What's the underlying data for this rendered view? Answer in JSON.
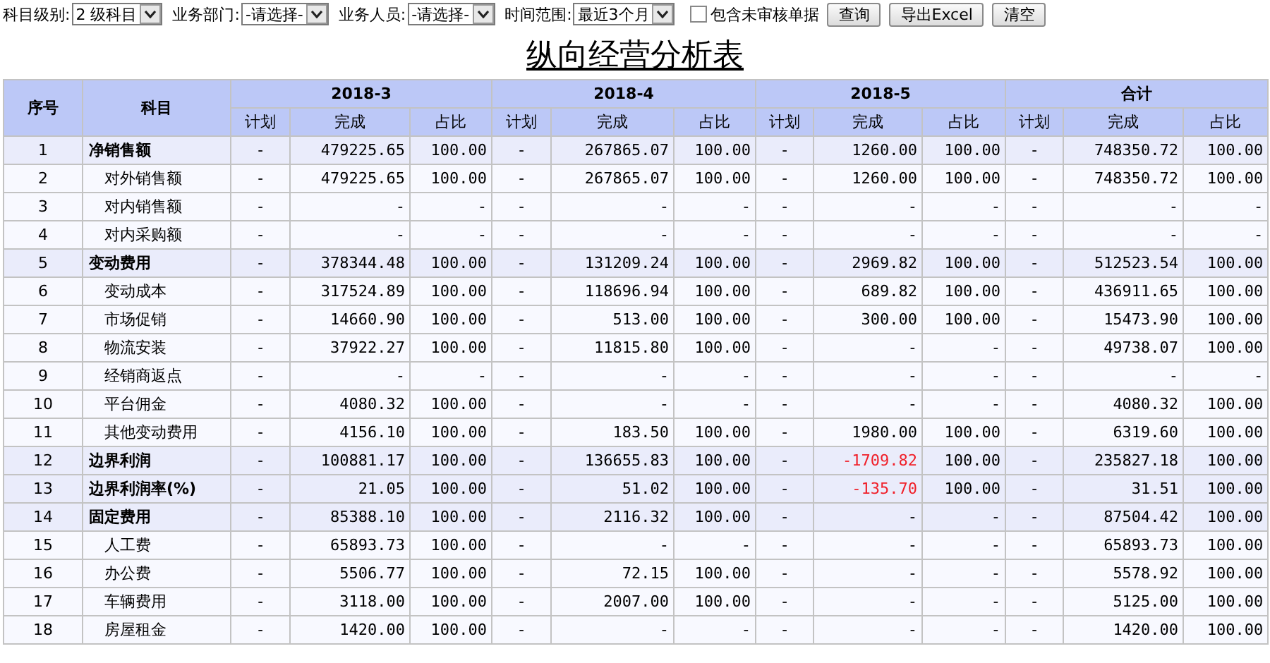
{
  "filters": [
    {
      "label": "科目级别:",
      "value": "2 级科目",
      "kind": "select"
    },
    {
      "label": "业务部门:",
      "value": "-请选择-",
      "kind": "select"
    },
    {
      "label": "业务人员:",
      "value": "-请选择-",
      "kind": "select"
    },
    {
      "label": "时间范围:",
      "value": "最近3个月",
      "kind": "select"
    }
  ],
  "checkbox": {
    "label": "包含未审核单据",
    "checked": false
  },
  "buttons": [
    "查询",
    "导出Excel",
    "清空"
  ],
  "title": "纵向经营分析表",
  "table": {
    "col_index": "序号",
    "col_subject": "科目",
    "periods": [
      {
        "label": "2018-3",
        "sub_columns": [
          "计划",
          "完成",
          "占比"
        ]
      },
      {
        "label": "2018-4",
        "sub_columns": [
          "计划",
          "完成",
          "占比"
        ]
      },
      {
        "label": "2018-5",
        "sub_columns": [
          "计划",
          "完成",
          "占比"
        ]
      },
      {
        "label": "合计",
        "sub_columns": [
          "计划",
          "完成",
          "占比"
        ]
      }
    ],
    "rows": [
      {
        "no": "1",
        "subject": "净销售额",
        "kind": "group",
        "cells": [
          {
            "plan": "-",
            "done": "479225.65",
            "share": "100.00",
            "negative": false
          },
          {
            "plan": "-",
            "done": "267865.07",
            "share": "100.00",
            "negative": false
          },
          {
            "plan": "-",
            "done": "1260.00",
            "share": "100.00",
            "negative": false
          },
          {
            "plan": "-",
            "done": "748350.72",
            "share": "100.00",
            "negative": false
          }
        ]
      },
      {
        "no": "2",
        "subject": "对外销售额",
        "kind": "item",
        "cells": [
          {
            "plan": "-",
            "done": "479225.65",
            "share": "100.00",
            "negative": false
          },
          {
            "plan": "-",
            "done": "267865.07",
            "share": "100.00",
            "negative": false
          },
          {
            "plan": "-",
            "done": "1260.00",
            "share": "100.00",
            "negative": false
          },
          {
            "plan": "-",
            "done": "748350.72",
            "share": "100.00",
            "negative": false
          }
        ]
      },
      {
        "no": "3",
        "subject": "对内销售额",
        "kind": "item",
        "cells": [
          {
            "plan": "-",
            "done": "-",
            "share": "-",
            "negative": false
          },
          {
            "plan": "-",
            "done": "-",
            "share": "-",
            "negative": false
          },
          {
            "plan": "-",
            "done": "-",
            "share": "-",
            "negative": false
          },
          {
            "plan": "-",
            "done": "-",
            "share": "-",
            "negative": false
          }
        ]
      },
      {
        "no": "4",
        "subject": "对内采购额",
        "kind": "item",
        "cells": [
          {
            "plan": "-",
            "done": "-",
            "share": "-",
            "negative": false
          },
          {
            "plan": "-",
            "done": "-",
            "share": "-",
            "negative": false
          },
          {
            "plan": "-",
            "done": "-",
            "share": "-",
            "negative": false
          },
          {
            "plan": "-",
            "done": "-",
            "share": "-",
            "negative": false
          }
        ]
      },
      {
        "no": "5",
        "subject": "变动费用",
        "kind": "group",
        "cells": [
          {
            "plan": "-",
            "done": "378344.48",
            "share": "100.00",
            "negative": false
          },
          {
            "plan": "-",
            "done": "131209.24",
            "share": "100.00",
            "negative": false
          },
          {
            "plan": "-",
            "done": "2969.82",
            "share": "100.00",
            "negative": false
          },
          {
            "plan": "-",
            "done": "512523.54",
            "share": "100.00",
            "negative": false
          }
        ]
      },
      {
        "no": "6",
        "subject": "变动成本",
        "kind": "item",
        "cells": [
          {
            "plan": "-",
            "done": "317524.89",
            "share": "100.00",
            "negative": false
          },
          {
            "plan": "-",
            "done": "118696.94",
            "share": "100.00",
            "negative": false
          },
          {
            "plan": "-",
            "done": "689.82",
            "share": "100.00",
            "negative": false
          },
          {
            "plan": "-",
            "done": "436911.65",
            "share": "100.00",
            "negative": false
          }
        ]
      },
      {
        "no": "7",
        "subject": "市场促销",
        "kind": "item",
        "cells": [
          {
            "plan": "-",
            "done": "14660.90",
            "share": "100.00",
            "negative": false
          },
          {
            "plan": "-",
            "done": "513.00",
            "share": "100.00",
            "negative": false
          },
          {
            "plan": "-",
            "done": "300.00",
            "share": "100.00",
            "negative": false
          },
          {
            "plan": "-",
            "done": "15473.90",
            "share": "100.00",
            "negative": false
          }
        ]
      },
      {
        "no": "8",
        "subject": "物流安装",
        "kind": "item",
        "cells": [
          {
            "plan": "-",
            "done": "37922.27",
            "share": "100.00",
            "negative": false
          },
          {
            "plan": "-",
            "done": "11815.80",
            "share": "100.00",
            "negative": false
          },
          {
            "plan": "-",
            "done": "-",
            "share": "-",
            "negative": false
          },
          {
            "plan": "-",
            "done": "49738.07",
            "share": "100.00",
            "negative": false
          }
        ]
      },
      {
        "no": "9",
        "subject": "经销商返点",
        "kind": "item",
        "cells": [
          {
            "plan": "-",
            "done": "-",
            "share": "-",
            "negative": false
          },
          {
            "plan": "-",
            "done": "-",
            "share": "-",
            "negative": false
          },
          {
            "plan": "-",
            "done": "-",
            "share": "-",
            "negative": false
          },
          {
            "plan": "-",
            "done": "-",
            "share": "-",
            "negative": false
          }
        ]
      },
      {
        "no": "10",
        "subject": "平台佣金",
        "kind": "item",
        "cells": [
          {
            "plan": "-",
            "done": "4080.32",
            "share": "100.00",
            "negative": false
          },
          {
            "plan": "-",
            "done": "-",
            "share": "-",
            "negative": false
          },
          {
            "plan": "-",
            "done": "-",
            "share": "-",
            "negative": false
          },
          {
            "plan": "-",
            "done": "4080.32",
            "share": "100.00",
            "negative": false
          }
        ]
      },
      {
        "no": "11",
        "subject": "其他变动费用",
        "kind": "item",
        "cells": [
          {
            "plan": "-",
            "done": "4156.10",
            "share": "100.00",
            "negative": false
          },
          {
            "plan": "-",
            "done": "183.50",
            "share": "100.00",
            "negative": false
          },
          {
            "plan": "-",
            "done": "1980.00",
            "share": "100.00",
            "negative": false
          },
          {
            "plan": "-",
            "done": "6319.60",
            "share": "100.00",
            "negative": false
          }
        ]
      },
      {
        "no": "12",
        "subject": "边界利润",
        "kind": "group",
        "cells": [
          {
            "plan": "-",
            "done": "100881.17",
            "share": "100.00",
            "negative": false
          },
          {
            "plan": "-",
            "done": "136655.83",
            "share": "100.00",
            "negative": false
          },
          {
            "plan": "-",
            "done": "-1709.82",
            "share": "100.00",
            "negative": true
          },
          {
            "plan": "-",
            "done": "235827.18",
            "share": "100.00",
            "negative": false
          }
        ]
      },
      {
        "no": "13",
        "subject": "边界利润率(%)",
        "kind": "group",
        "cells": [
          {
            "plan": "-",
            "done": "21.05",
            "share": "100.00",
            "negative": false
          },
          {
            "plan": "-",
            "done": "51.02",
            "share": "100.00",
            "negative": false
          },
          {
            "plan": "-",
            "done": "-135.70",
            "share": "100.00",
            "negative": true
          },
          {
            "plan": "-",
            "done": "31.51",
            "share": "100.00",
            "negative": false
          }
        ]
      },
      {
        "no": "14",
        "subject": "固定费用",
        "kind": "group",
        "cells": [
          {
            "plan": "-",
            "done": "85388.10",
            "share": "100.00",
            "negative": false
          },
          {
            "plan": "-",
            "done": "2116.32",
            "share": "100.00",
            "negative": false
          },
          {
            "plan": "-",
            "done": "-",
            "share": "-",
            "negative": false
          },
          {
            "plan": "-",
            "done": "87504.42",
            "share": "100.00",
            "negative": false
          }
        ]
      },
      {
        "no": "15",
        "subject": "人工费",
        "kind": "item",
        "cells": [
          {
            "plan": "-",
            "done": "65893.73",
            "share": "100.00",
            "negative": false
          },
          {
            "plan": "-",
            "done": "-",
            "share": "-",
            "negative": false
          },
          {
            "plan": "-",
            "done": "-",
            "share": "-",
            "negative": false
          },
          {
            "plan": "-",
            "done": "65893.73",
            "share": "100.00",
            "negative": false
          }
        ]
      },
      {
        "no": "16",
        "subject": "办公费",
        "kind": "item",
        "cells": [
          {
            "plan": "-",
            "done": "5506.77",
            "share": "100.00",
            "negative": false
          },
          {
            "plan": "-",
            "done": "72.15",
            "share": "100.00",
            "negative": false
          },
          {
            "plan": "-",
            "done": "-",
            "share": "-",
            "negative": false
          },
          {
            "plan": "-",
            "done": "5578.92",
            "share": "100.00",
            "negative": false
          }
        ]
      },
      {
        "no": "17",
        "subject": "车辆费用",
        "kind": "item",
        "cells": [
          {
            "plan": "-",
            "done": "3118.00",
            "share": "100.00",
            "negative": false
          },
          {
            "plan": "-",
            "done": "2007.00",
            "share": "100.00",
            "negative": false
          },
          {
            "plan": "-",
            "done": "-",
            "share": "-",
            "negative": false
          },
          {
            "plan": "-",
            "done": "5125.00",
            "share": "100.00",
            "negative": false
          }
        ]
      },
      {
        "no": "18",
        "subject": "房屋租金",
        "kind": "item",
        "cells": [
          {
            "plan": "-",
            "done": "1420.00",
            "share": "100.00",
            "negative": false
          },
          {
            "plan": "-",
            "done": "-",
            "share": "-",
            "negative": false
          },
          {
            "plan": "-",
            "done": "-",
            "share": "-",
            "negative": false
          },
          {
            "plan": "-",
            "done": "1420.00",
            "share": "100.00",
            "negative": false
          }
        ]
      }
    ]
  }
}
